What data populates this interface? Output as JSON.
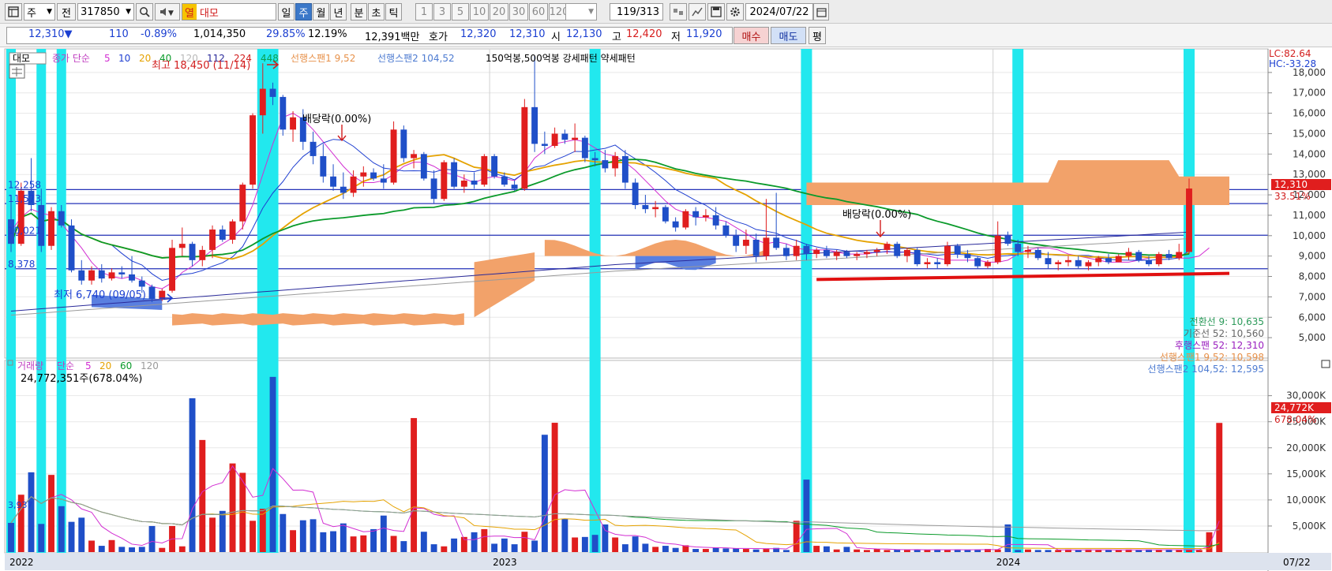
{
  "toolbar": {
    "menu_icon": "window-menu-icon",
    "period_select": "주",
    "prev_label": "전",
    "code_value": "317850",
    "search_icon": "search-icon",
    "sound_icon": "speaker-icon",
    "name_tag": "열",
    "stock_name": "대모",
    "periods": [
      "일",
      "주",
      "월",
      "년",
      "분",
      "초",
      "틱"
    ],
    "active_period": "주",
    "intervals": [
      "1",
      "3",
      "5",
      "10",
      "20",
      "30",
      "60",
      "120"
    ],
    "page_count": "119",
    "page_total": "/313",
    "date_value": "2024/07/22",
    "calendar_icon": "calendar-icon",
    "settings_icon": "gear-icon",
    "save_icon": "save-icon"
  },
  "quote": {
    "price": "12,310▼",
    "change": "110",
    "change_pct": "-0.89%",
    "volume": "1,014,350",
    "vol_ratio": "29.85%",
    "turnover_pct": "12.19%",
    "amount": "12,391백만",
    "bid_label": "호가",
    "bid": "12,320",
    "ask": "12,310",
    "open_label": "시",
    "open": "12,130",
    "high_label": "고",
    "high": "12,420",
    "low_label": "저",
    "low": "11,920",
    "buy_button": "매수",
    "sell_button": "매도",
    "avg_button": "평"
  },
  "legend": {
    "name": "대모",
    "ma_title": "종가 단순",
    "ma_periods": [
      "5",
      "10",
      "20",
      "40",
      "120",
      "112",
      "224",
      "448"
    ],
    "ma_colors": [
      "#d22fd2",
      "#1f3fd1",
      "#e5a200",
      "#0a9a2a",
      "#b9b9b9",
      "#2a2a9a",
      "#d21e1e",
      "#0aa050"
    ],
    "lead1": "선행스팬1 9,52",
    "lead2": "선행스팬2 104,52",
    "pattern_label": "150억봉,500억봉 강세패턴   약세패턴"
  },
  "annotations": {
    "high_note": "최고 18,450 (11/14)",
    "low_note": "최저 6,740 (09/05)",
    "div1": "배당락(0.00%)",
    "div2": "배당락(0.00%)",
    "hline_labels": [
      "12,258",
      "11,573",
      "10,021",
      "8,378"
    ],
    "lc": "LC:82.64",
    "hc": "HC:-33.28",
    "price_tag": "12,310",
    "price_pct": "33.51%"
  },
  "ichimoku_readout": [
    {
      "label": "전환선 9: 10,635",
      "color": "#2c9a5a"
    },
    {
      "label": "기준선 52: 10,560",
      "color": "#666666"
    },
    {
      "label": "후행스팬 52: 12,310",
      "color": "#9a1fbf"
    },
    {
      "label": "선행스팬1 9,52: 10,598",
      "color": "#e7914a"
    },
    {
      "label": "선행스팬2 104,52: 12,595",
      "color": "#4d7bd1"
    }
  ],
  "volume_legend": {
    "title": "거래량",
    "ma_title": "단순",
    "periods": [
      "5",
      "20",
      "60",
      "120"
    ],
    "colors": [
      "#d22fd2",
      "#e5a200",
      "#0a9a2a",
      "#9a9a9a"
    ],
    "value": "24,772,351주(678.04%)",
    "min_tag": "3,937",
    "tag_vol": "24,772K",
    "tag_pct": "678.04%"
  },
  "x_axis": {
    "labels": [
      "2022",
      "2023",
      "2024"
    ],
    "end_label": "07/22"
  },
  "chart_data": [
    {
      "type": "candlestick",
      "title": "대모",
      "ylim": [
        4000,
        19000
      ],
      "y_ticks": [
        5000,
        6000,
        7000,
        8000,
        9000,
        10000,
        11000,
        12000,
        13000,
        14000,
        15000,
        16000,
        17000,
        18000
      ],
      "candles": [
        [
          10800,
          11900,
          9200,
          9600
        ],
        [
          9600,
          12600,
          9500,
          12200
        ],
        [
          12200,
          13800,
          11200,
          11500
        ],
        [
          11500,
          12300,
          9200,
          9500
        ],
        [
          9500,
          11400,
          9300,
          11200
        ],
        [
          11200,
          11500,
          10400,
          10500
        ],
        [
          10500,
          10800,
          8200,
          8300
        ],
        [
          8300,
          8800,
          7600,
          7800
        ],
        [
          7800,
          8500,
          7600,
          8300
        ],
        [
          8300,
          8600,
          7700,
          7900
        ],
        [
          7900,
          8400,
          7800,
          8200
        ],
        [
          8200,
          8500,
          7900,
          8100
        ],
        [
          8100,
          9000,
          7700,
          7800
        ],
        [
          7800,
          8000,
          7200,
          7500
        ],
        [
          7500,
          7600,
          6740,
          6900
        ],
        [
          6900,
          7400,
          6800,
          7300
        ],
        [
          7300,
          9800,
          7200,
          9400
        ],
        [
          9400,
          10400,
          9000,
          9600
        ],
        [
          9600,
          9700,
          8500,
          8800
        ],
        [
          8800,
          9500,
          8500,
          9300
        ],
        [
          9300,
          10500,
          8900,
          10300
        ],
        [
          10300,
          10500,
          9700,
          9800
        ],
        [
          9800,
          10800,
          9600,
          10700
        ],
        [
          10700,
          12600,
          10300,
          12500
        ],
        [
          12500,
          16000,
          12300,
          15900
        ],
        [
          15900,
          18450,
          15000,
          17200
        ],
        [
          17200,
          17500,
          16400,
          16800
        ],
        [
          16800,
          16900,
          14900,
          15200
        ],
        [
          15200,
          16100,
          14600,
          15800
        ],
        [
          15800,
          16200,
          14200,
          14600
        ],
        [
          14600,
          15100,
          13500,
          13900
        ],
        [
          13900,
          14500,
          12600,
          12900
        ],
        [
          12900,
          13500,
          12200,
          12400
        ],
        [
          12400,
          13100,
          11800,
          12100
        ],
        [
          12100,
          13200,
          11900,
          12900
        ],
        [
          12900,
          13400,
          12400,
          13100
        ],
        [
          13100,
          13300,
          12700,
          12800
        ],
        [
          12800,
          13500,
          12300,
          12600
        ],
        [
          12600,
          15600,
          12500,
          15200
        ],
        [
          15200,
          15400,
          13600,
          13800
        ],
        [
          13800,
          14200,
          13300,
          14000
        ],
        [
          14000,
          14100,
          12700,
          12800
        ],
        [
          12800,
          13200,
          11600,
          11800
        ],
        [
          11800,
          13700,
          11700,
          13600
        ],
        [
          13600,
          13800,
          12300,
          12400
        ],
        [
          12400,
          13000,
          12100,
          12700
        ],
        [
          12700,
          13100,
          12300,
          12500
        ],
        [
          12500,
          14000,
          12400,
          13900
        ],
        [
          13900,
          14000,
          12800,
          12900
        ],
        [
          12900,
          13100,
          12400,
          12500
        ],
        [
          12500,
          12700,
          12200,
          12300
        ],
        [
          12300,
          16700,
          12200,
          16300
        ],
        [
          16300,
          18800,
          14100,
          14500
        ],
        [
          14500,
          15100,
          14000,
          14400
        ],
        [
          14400,
          15300,
          14300,
          15000
        ],
        [
          15000,
          15200,
          14500,
          14700
        ],
        [
          14700,
          15500,
          14100,
          14800
        ],
        [
          14800,
          14900,
          13600,
          13800
        ],
        [
          13800,
          14100,
          13400,
          13700
        ],
        [
          13700,
          14200,
          13100,
          13300
        ],
        [
          13300,
          14100,
          12900,
          13900
        ],
        [
          13900,
          14200,
          12300,
          12600
        ],
        [
          12600,
          12800,
          11300,
          11500
        ],
        [
          11500,
          12000,
          11100,
          11300
        ],
        [
          11300,
          11700,
          10900,
          11400
        ],
        [
          11400,
          11500,
          10600,
          10700
        ],
        [
          10700,
          10900,
          10200,
          10400
        ],
        [
          10400,
          11300,
          10300,
          11200
        ],
        [
          11200,
          11400,
          10500,
          10900
        ],
        [
          10900,
          11300,
          10700,
          11000
        ],
        [
          11000,
          11400,
          10300,
          10500
        ],
        [
          10500,
          10700,
          9900,
          10000
        ],
        [
          10000,
          10300,
          9200,
          9500
        ],
        [
          9500,
          10300,
          9100,
          9800
        ],
        [
          9800,
          10100,
          8700,
          9000
        ],
        [
          9000,
          11800,
          8800,
          9900
        ],
        [
          9900,
          12100,
          9300,
          9400
        ],
        [
          9400,
          9600,
          8800,
          9000
        ],
        [
          9000,
          9800,
          8800,
          9500
        ],
        [
          9500,
          9600,
          8800,
          9100
        ],
        [
          9100,
          9400,
          8900,
          9300
        ],
        [
          9300,
          9500,
          8900,
          9000
        ],
        [
          9000,
          9300,
          8800,
          9200
        ],
        [
          9200,
          9300,
          8900,
          9000
        ],
        [
          9000,
          9200,
          8800,
          9100
        ],
        [
          9100,
          9300,
          8900,
          9200
        ],
        [
          9200,
          9400,
          9000,
          9300
        ],
        [
          9300,
          9700,
          9100,
          9600
        ],
        [
          9600,
          9700,
          8900,
          9000
        ],
        [
          9000,
          9400,
          8700,
          9300
        ],
        [
          9300,
          9400,
          8500,
          8600
        ],
        [
          8600,
          8900,
          8400,
          8700
        ],
        [
          8700,
          8900,
          8400,
          8600
        ],
        [
          8600,
          9700,
          8500,
          9500
        ],
        [
          9500,
          9600,
          8900,
          9100
        ],
        [
          9100,
          9300,
          8700,
          8900
        ],
        [
          8900,
          9000,
          8400,
          8500
        ],
        [
          8500,
          8800,
          8400,
          8700
        ],
        [
          8700,
          10700,
          8600,
          10000
        ],
        [
          10000,
          10200,
          9500,
          9600
        ],
        [
          9600,
          9800,
          9000,
          9200
        ],
        [
          9200,
          9500,
          8900,
          9300
        ],
        [
          9300,
          9400,
          8800,
          8900
        ],
        [
          8900,
          9200,
          8400,
          8600
        ],
        [
          8600,
          8800,
          8300,
          8700
        ],
        [
          8700,
          9000,
          8500,
          8800
        ],
        [
          8800,
          9000,
          8400,
          8500
        ],
        [
          8500,
          8800,
          8300,
          8700
        ],
        [
          8700,
          9000,
          8500,
          8900
        ],
        [
          8900,
          9100,
          8600,
          8700
        ],
        [
          8700,
          9100,
          8700,
          9000
        ],
        [
          9000,
          9400,
          8800,
          9200
        ],
        [
          9200,
          9300,
          8700,
          8800
        ],
        [
          8800,
          9000,
          8500,
          8600
        ],
        [
          8600,
          9200,
          8500,
          9100
        ],
        [
          9100,
          9300,
          8800,
          8900
        ],
        [
          8900,
          9600,
          8800,
          9200
        ],
        [
          9200,
          12800,
          9100,
          12310
        ]
      ],
      "ma_lines": {
        "ma5": [
          10200,
          10900,
          11300,
          11100,
          11000,
          10600,
          10000,
          9400,
          8700,
          8200,
          8000,
          7900,
          8000,
          7800,
          7500,
          7400,
          7700,
          8200,
          8500,
          8900,
          9300,
          9600,
          9900,
          10400,
          11500,
          13000,
          14500,
          15800,
          16000,
          15700,
          15200,
          14600,
          14000,
          13400,
          12900,
          12600,
          12600,
          12700,
          13000,
          13400,
          13600,
          13600,
          13400,
          13100,
          13000,
          12800,
          12600,
          12800,
          12900,
          12800,
          12700,
          13100,
          13800,
          14200,
          14500,
          14600,
          14700,
          14600,
          14300,
          14000,
          13900,
          13600,
          13200,
          12700,
          12200,
          11700,
          11300,
          11100,
          10900,
          10900,
          10800,
          10700,
          10400,
          10100,
          9800,
          9600,
          9700,
          9600,
          9400,
          9300,
          9300,
          9300,
          9200,
          9100,
          9100,
          9100,
          9200,
          9200,
          9200,
          9200,
          9100,
          9000,
          8900,
          8800,
          8800,
          8800,
          8800,
          8700,
          8700,
          8800,
          9100,
          9300,
          9400,
          9400,
          9300,
          9100,
          9000,
          8900,
          8800,
          8700,
          8700,
          8700,
          8800,
          8900,
          9000,
          9000,
          8900,
          8900,
          9000,
          9400
        ]
      }
    },
    {
      "type": "bar",
      "title": "거래량",
      "ylim": [
        0,
        36000
      ],
      "y_ticks": [
        5000,
        10000,
        15000,
        20000,
        25000,
        30000
      ],
      "values_k": [
        5600,
        11000,
        15300,
        5400,
        14800,
        8800,
        5800,
        6600,
        2200,
        1200,
        2300,
        1000,
        900,
        1000,
        5000,
        800,
        5000,
        1100,
        29500,
        21500,
        6600,
        7900,
        17000,
        15200,
        6000,
        8300,
        33600,
        7300,
        4200,
        6100,
        6300,
        3800,
        4000,
        5500,
        3000,
        3200,
        4400,
        7000,
        3100,
        2100,
        25700,
        3900,
        1500,
        1100,
        2600,
        2900,
        3800,
        4400,
        1600,
        2600,
        1500,
        3900,
        2200,
        22500,
        24800,
        6400,
        2800,
        2900,
        3300,
        5300,
        2800,
        1500,
        3000,
        1600,
        1000,
        1200,
        800,
        1300,
        600,
        600,
        900,
        700,
        700,
        600,
        500,
        700,
        800,
        400,
        6000,
        13900,
        1200,
        1100,
        500,
        1000,
        500,
        400,
        600,
        400,
        500,
        400,
        500,
        400,
        500,
        400,
        500,
        400,
        500,
        600,
        500,
        5300,
        400,
        500,
        400,
        400,
        400,
        500,
        400,
        500,
        400,
        400,
        400,
        500,
        400,
        500,
        400,
        500,
        400,
        500,
        400,
        3800,
        24772
      ]
    }
  ]
}
